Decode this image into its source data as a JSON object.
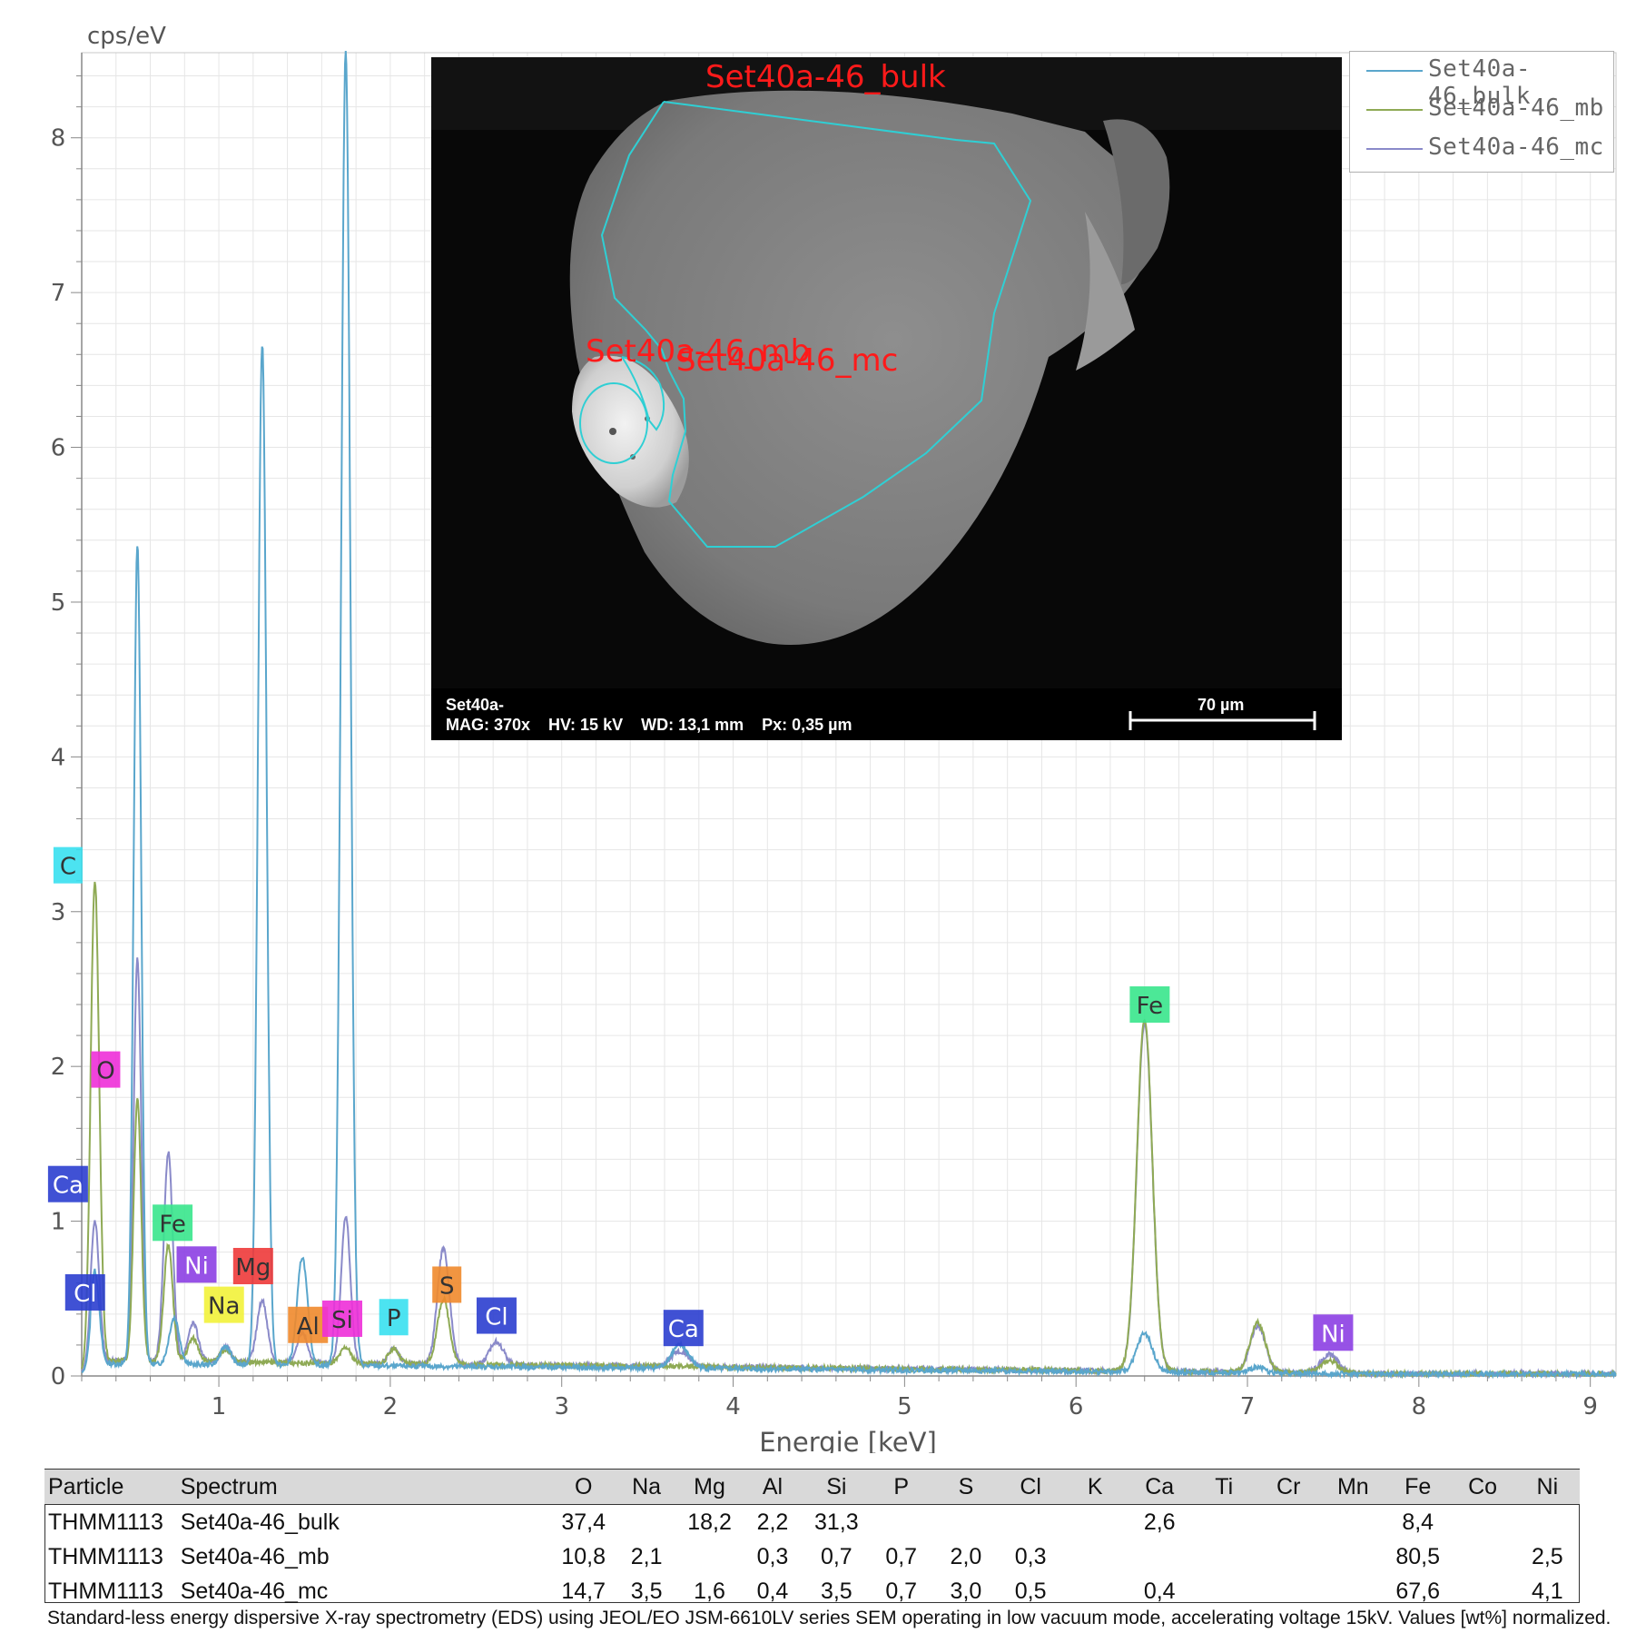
{
  "chart_data": {
    "type": "line",
    "ylabel": "cps/eV",
    "xlabel": "Energie [keV]",
    "xlim": [
      0.2,
      9.15
    ],
    "ylim": [
      0,
      8.55
    ],
    "xticks": [
      1,
      2,
      3,
      4,
      5,
      6,
      7,
      8,
      9
    ],
    "yticks": [
      0,
      1,
      2,
      3,
      4,
      5,
      6,
      7,
      8
    ],
    "grid": true,
    "legend_position": "top-right",
    "series": [
      {
        "name": "Set40a-46_bulk",
        "color": "#5aa6cc",
        "baseline": 0.08,
        "peaks": [
          [
            0.277,
            0.6,
            0.025
          ],
          [
            0.525,
            5.3,
            0.022
          ],
          [
            0.74,
            0.3,
            0.03
          ],
          [
            1.04,
            0.12,
            0.03
          ],
          [
            1.253,
            6.6,
            0.025
          ],
          [
            1.487,
            0.7,
            0.03
          ],
          [
            1.74,
            8.5,
            0.027
          ],
          [
            3.69,
            0.15,
            0.05
          ],
          [
            6.4,
            0.25,
            0.045
          ],
          [
            7.06,
            0.04,
            0.04
          ]
        ]
      },
      {
        "name": "Set40a-46_mb",
        "color": "#8faa55",
        "baseline": 0.1,
        "peaks": [
          [
            0.277,
            3.1,
            0.025
          ],
          [
            0.525,
            1.7,
            0.022
          ],
          [
            0.705,
            0.75,
            0.026
          ],
          [
            0.85,
            0.15,
            0.03
          ],
          [
            1.04,
            0.08,
            0.03
          ],
          [
            1.74,
            0.1,
            0.03
          ],
          [
            2.02,
            0.1,
            0.03
          ],
          [
            2.31,
            0.42,
            0.035
          ],
          [
            6.4,
            2.28,
            0.045
          ],
          [
            7.06,
            0.32,
            0.045
          ],
          [
            7.48,
            0.08,
            0.05
          ]
        ]
      },
      {
        "name": "Set40a-46_mc",
        "color": "#8a8ac9",
        "baseline": 0.1,
        "peaks": [
          [
            0.277,
            0.9,
            0.025
          ],
          [
            0.525,
            2.6,
            0.022
          ],
          [
            0.705,
            1.35,
            0.026
          ],
          [
            0.85,
            0.25,
            0.03
          ],
          [
            1.04,
            0.1,
            0.03
          ],
          [
            1.253,
            0.4,
            0.03
          ],
          [
            1.487,
            0.2,
            0.03
          ],
          [
            1.74,
            0.95,
            0.027
          ],
          [
            2.02,
            0.1,
            0.03
          ],
          [
            2.31,
            0.75,
            0.035
          ],
          [
            2.62,
            0.15,
            0.04
          ],
          [
            3.69,
            0.1,
            0.05
          ],
          [
            6.4,
            2.25,
            0.045
          ],
          [
            7.06,
            0.3,
            0.045
          ],
          [
            7.48,
            0.12,
            0.05
          ]
        ]
      }
    ],
    "element_markers": [
      {
        "label": "C",
        "x": 0.12,
        "y": 3.3,
        "color": "#39e0f0"
      },
      {
        "label": "O",
        "x": 0.34,
        "y": 1.98,
        "color": "#ee2fd8"
      },
      {
        "label": "Ca",
        "x": 0.12,
        "y": 1.24,
        "color": "#2b3ecf"
      },
      {
        "label": "Fe",
        "x": 0.73,
        "y": 0.99,
        "color": "#39e58c"
      },
      {
        "label": "Ni",
        "x": 0.87,
        "y": 0.72,
        "color": "#8c3fe3"
      },
      {
        "label": "Mg",
        "x": 1.2,
        "y": 0.71,
        "color": "#ee3a3a"
      },
      {
        "label": "Na",
        "x": 1.03,
        "y": 0.46,
        "color": "#f2f23a"
      },
      {
        "label": "Al",
        "x": 1.52,
        "y": 0.33,
        "color": "#f08a2c"
      },
      {
        "label": "Si",
        "x": 1.72,
        "y": 0.37,
        "color": "#ee2fd8"
      },
      {
        "label": "P",
        "x": 2.02,
        "y": 0.38,
        "color": "#39e0f0"
      },
      {
        "label": "S",
        "x": 2.33,
        "y": 0.59,
        "color": "#f08a2c"
      },
      {
        "label": "Cl",
        "x": 2.62,
        "y": 0.39,
        "color": "#2b3ecf"
      },
      {
        "label": "Ca",
        "x": 3.71,
        "y": 0.31,
        "color": "#2b3ecf"
      },
      {
        "label": "Fe",
        "x": 6.43,
        "y": 2.4,
        "color": "#39e58c"
      },
      {
        "label": "Ni",
        "x": 7.5,
        "y": 0.28,
        "color": "#8c3fe3"
      },
      {
        "label": "Cl",
        "x": 0.22,
        "y": 0.54,
        "color": "#2b3ecf"
      }
    ]
  },
  "sem_image": {
    "labels": {
      "bulk": "Set40a-46_bulk",
      "mb": "Set40a-46_mb",
      "mc": "Set40a-46_mc"
    },
    "footer_line1": "Set40a-",
    "footer_line2": "MAG: 370x    HV: 15 kV    WD: 13,1 mm    Px: 0,35 µm",
    "scale_bar": "70 µm"
  },
  "table": {
    "headers": [
      "Particle",
      "Spectrum",
      "O",
      "Na",
      "Mg",
      "Al",
      "Si",
      "P",
      "S",
      "Cl",
      "K",
      "Ca",
      "Ti",
      "Cr",
      "Mn",
      "Fe",
      "Co",
      "Ni"
    ],
    "rows": [
      [
        "THMM1113",
        "Set40a-46_bulk",
        "37,4",
        "",
        "18,2",
        "2,2",
        "31,3",
        "",
        "",
        "",
        "",
        "2,6",
        "",
        "",
        "",
        "8,4",
        "",
        ""
      ],
      [
        "THMM1113",
        "Set40a-46_mb",
        "10,8",
        "2,1",
        "",
        "0,3",
        "0,7",
        "0,7",
        "2,0",
        "0,3",
        "",
        "",
        "",
        "",
        "",
        "80,5",
        "",
        "2,5"
      ],
      [
        "THMM1113",
        "Set40a-46_mc",
        "14,7",
        "3,5",
        "1,6",
        "0,4",
        "3,5",
        "0,7",
        "3,0",
        "0,5",
        "",
        "0,4",
        "",
        "",
        "",
        "67,6",
        "",
        "4,1"
      ]
    ]
  },
  "caption": "Standard-less energy dispersive X-ray spectrometry (EDS) using JEOL/EO JSM-6610LV series SEM operating in low vacuum mode, accelerating voltage 15kV. Values [wt%] normalized."
}
